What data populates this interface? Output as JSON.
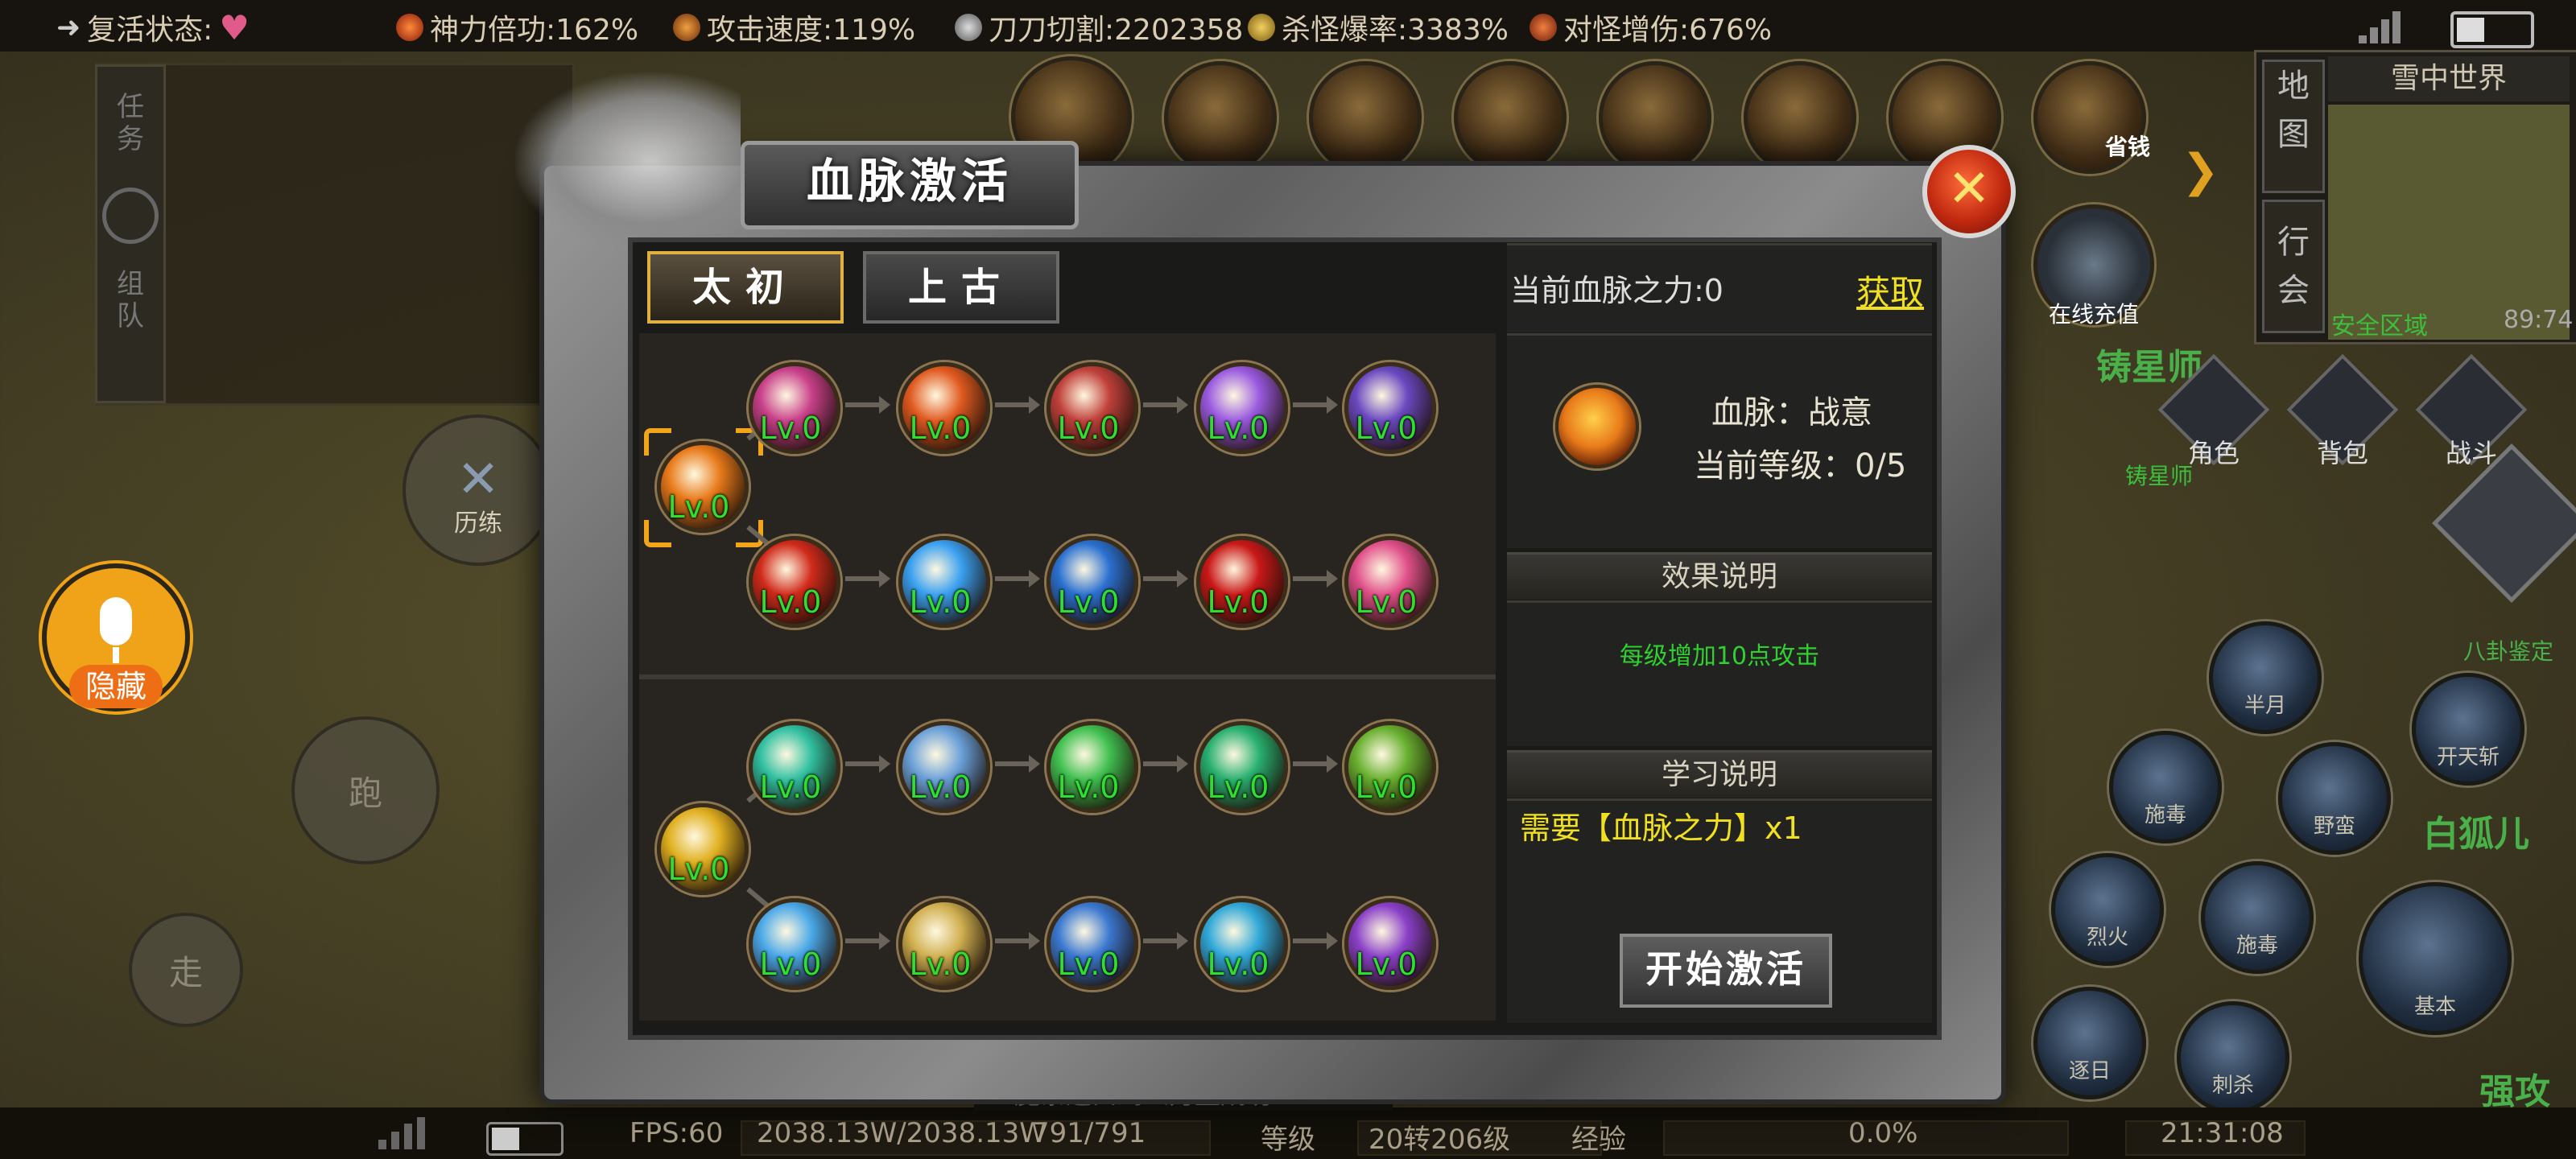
{
  "top_bar": {
    "revive_label": "复活状态:",
    "stats": [
      {
        "label": "神力倍功:162%",
        "icon": "flame-icon",
        "color": "#d94b2b"
      },
      {
        "label": "攻击速度:119%",
        "icon": "clock-icon",
        "color": "#c86a22"
      },
      {
        "label": "刀刀切割:2202358",
        "icon": "skull-icon",
        "color": "#aaaaaa"
      },
      {
        "label": "杀怪爆率:3383%",
        "icon": "coin-icon",
        "color": "#c8a030"
      },
      {
        "label": "对怪增伤:676%",
        "icon": "sword-icon",
        "color": "#c0502a"
      }
    ]
  },
  "left_hud": {
    "side_tabs": [
      "任务",
      "组队"
    ],
    "training_label": "历练",
    "mic_label": "隐藏",
    "run_label": "跑",
    "walk_label": "走"
  },
  "right_hud": {
    "map_tab": "地图",
    "guild_tab": "行会",
    "world_name": "雪中世界",
    "safe_zone": "安全区域",
    "coords": "89:74",
    "top_icon_label": "省钱",
    "online_label": "在线充值",
    "npc_title": "铸星师",
    "npc_title2": "铸星师",
    "menu": [
      "角色",
      "背包",
      "战斗"
    ],
    "skills": [
      "半月",
      "开天斩",
      "施毒",
      "野蛮",
      "烈火",
      "施毒",
      "基本",
      "逐日",
      "刺杀"
    ],
    "side_texts": [
      "八卦鉴定",
      "白狐儿",
      "强攻"
    ]
  },
  "dialog": {
    "title": "血脉激活",
    "close_symbol": "✕",
    "tabs": [
      {
        "label": "太初",
        "active": true
      },
      {
        "label": "上古",
        "active": false
      }
    ],
    "bloodline_power_label": "当前血脉之力:0",
    "obtain_link": "获取",
    "selected": {
      "name": "血脉：战意",
      "level": "当前等级：0/5"
    },
    "effect_header": "效果说明",
    "effect_text": "每级增加10点攻击",
    "learn_header": "学习说明",
    "learn_text": "需要【血脉之力】x1",
    "activate_button": "开始激活",
    "node_level": "Lv.0",
    "tree1": {
      "root": {
        "icon": "fire-orb-icon",
        "color": "#e87a1a",
        "selected": true
      },
      "row_top": [
        {
          "icon": "pink-figure-icon",
          "color": "#c8408a"
        },
        {
          "icon": "fire-swirl-icon",
          "color": "#e05a20"
        },
        {
          "icon": "crimson-beast-icon",
          "color": "#c0403a"
        },
        {
          "icon": "violet-burst-icon",
          "color": "#9a5ae0"
        },
        {
          "icon": "purple-spirit-icon",
          "color": "#6a48c0"
        }
      ],
      "row_bottom": [
        {
          "icon": "red-blade-icon",
          "color": "#d02a1a"
        },
        {
          "icon": "blue-star-icon",
          "color": "#3aa0f0"
        },
        {
          "icon": "blue-crescent-icon",
          "color": "#2a70d0"
        },
        {
          "icon": "red-claw-icon",
          "color": "#c81818"
        },
        {
          "icon": "pink-crystal-icon",
          "color": "#e0508a"
        }
      ]
    },
    "tree2": {
      "root": {
        "icon": "gold-swirl-icon",
        "color": "#e0b020"
      },
      "row_top": [
        {
          "icon": "teal-wave-icon",
          "color": "#30c0a0"
        },
        {
          "icon": "ice-mountain-icon",
          "color": "#6aa0d8"
        },
        {
          "icon": "green-wings-icon",
          "color": "#40c050"
        },
        {
          "icon": "jade-ring-icon",
          "color": "#28b070"
        },
        {
          "icon": "green-leaf-icon",
          "color": "#68b030"
        }
      ],
      "row_bottom": [
        {
          "icon": "blue-warrior-icon",
          "color": "#4aa8e8"
        },
        {
          "icon": "gold-shield-icon",
          "color": "#d0b050"
        },
        {
          "icon": "lightning-icon",
          "color": "#3a78d0"
        },
        {
          "icon": "cyan-tornado-icon",
          "color": "#30a8d8"
        },
        {
          "icon": "purple-figure-icon",
          "color": "#8a40c8"
        }
      ]
    }
  },
  "bottom_bar": {
    "fps": "FPS:60",
    "hp": "2038.13W/2038.13W",
    "mp": "791/791",
    "level_label": "等级",
    "level_value": "20转206级",
    "exp_label": "经验",
    "exp_value": "0.0%",
    "time": "21:31:08",
    "chat_hint": "魔条这口到么力量成功..."
  }
}
